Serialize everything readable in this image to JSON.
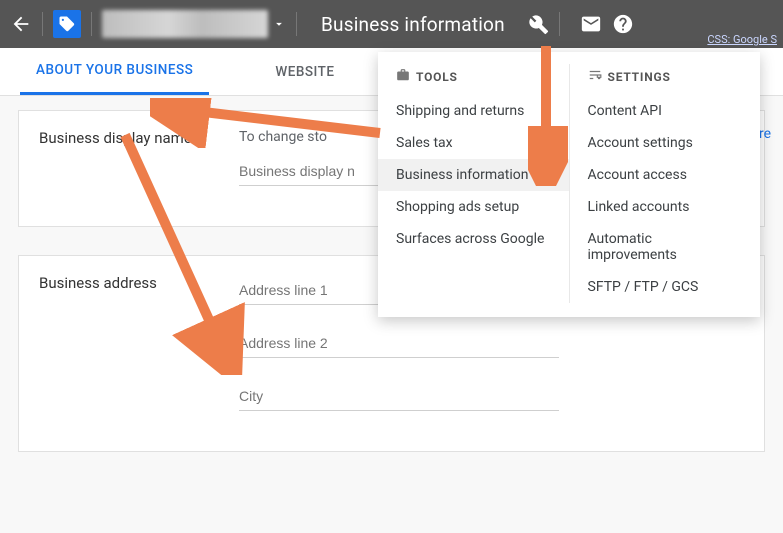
{
  "header": {
    "title": "Business information",
    "css_link": "CSS: Google S"
  },
  "tabs": {
    "about": "ABOUT YOUR BUSINESS",
    "website": "WEBSITE"
  },
  "display_card": {
    "label": "Business display name",
    "hint": "To change       sto",
    "placeholder": "Business display n",
    "learn_more": "ore"
  },
  "address_card": {
    "label": "Business address",
    "addr1_placeholder": "Address line 1",
    "addr2_placeholder": "Address line 2",
    "city_placeholder": "City"
  },
  "menu": {
    "tools_head": "TOOLS",
    "settings_head": "SETTINGS",
    "tools": {
      "shipping": "Shipping and returns",
      "sales_tax": "Sales tax",
      "business_info": "Business information",
      "shopping_ads": "Shopping ads setup",
      "surfaces": "Surfaces across Google"
    },
    "settings": {
      "content_api": "Content API",
      "account_settings": "Account settings",
      "account_access": "Account access",
      "linked_accounts": "Linked accounts",
      "auto_improvements": "Automatic improvements",
      "sftp": "SFTP / FTP / GCS"
    }
  },
  "colors": {
    "accent": "#1a73e8",
    "arrow": "#ed7d4a"
  }
}
